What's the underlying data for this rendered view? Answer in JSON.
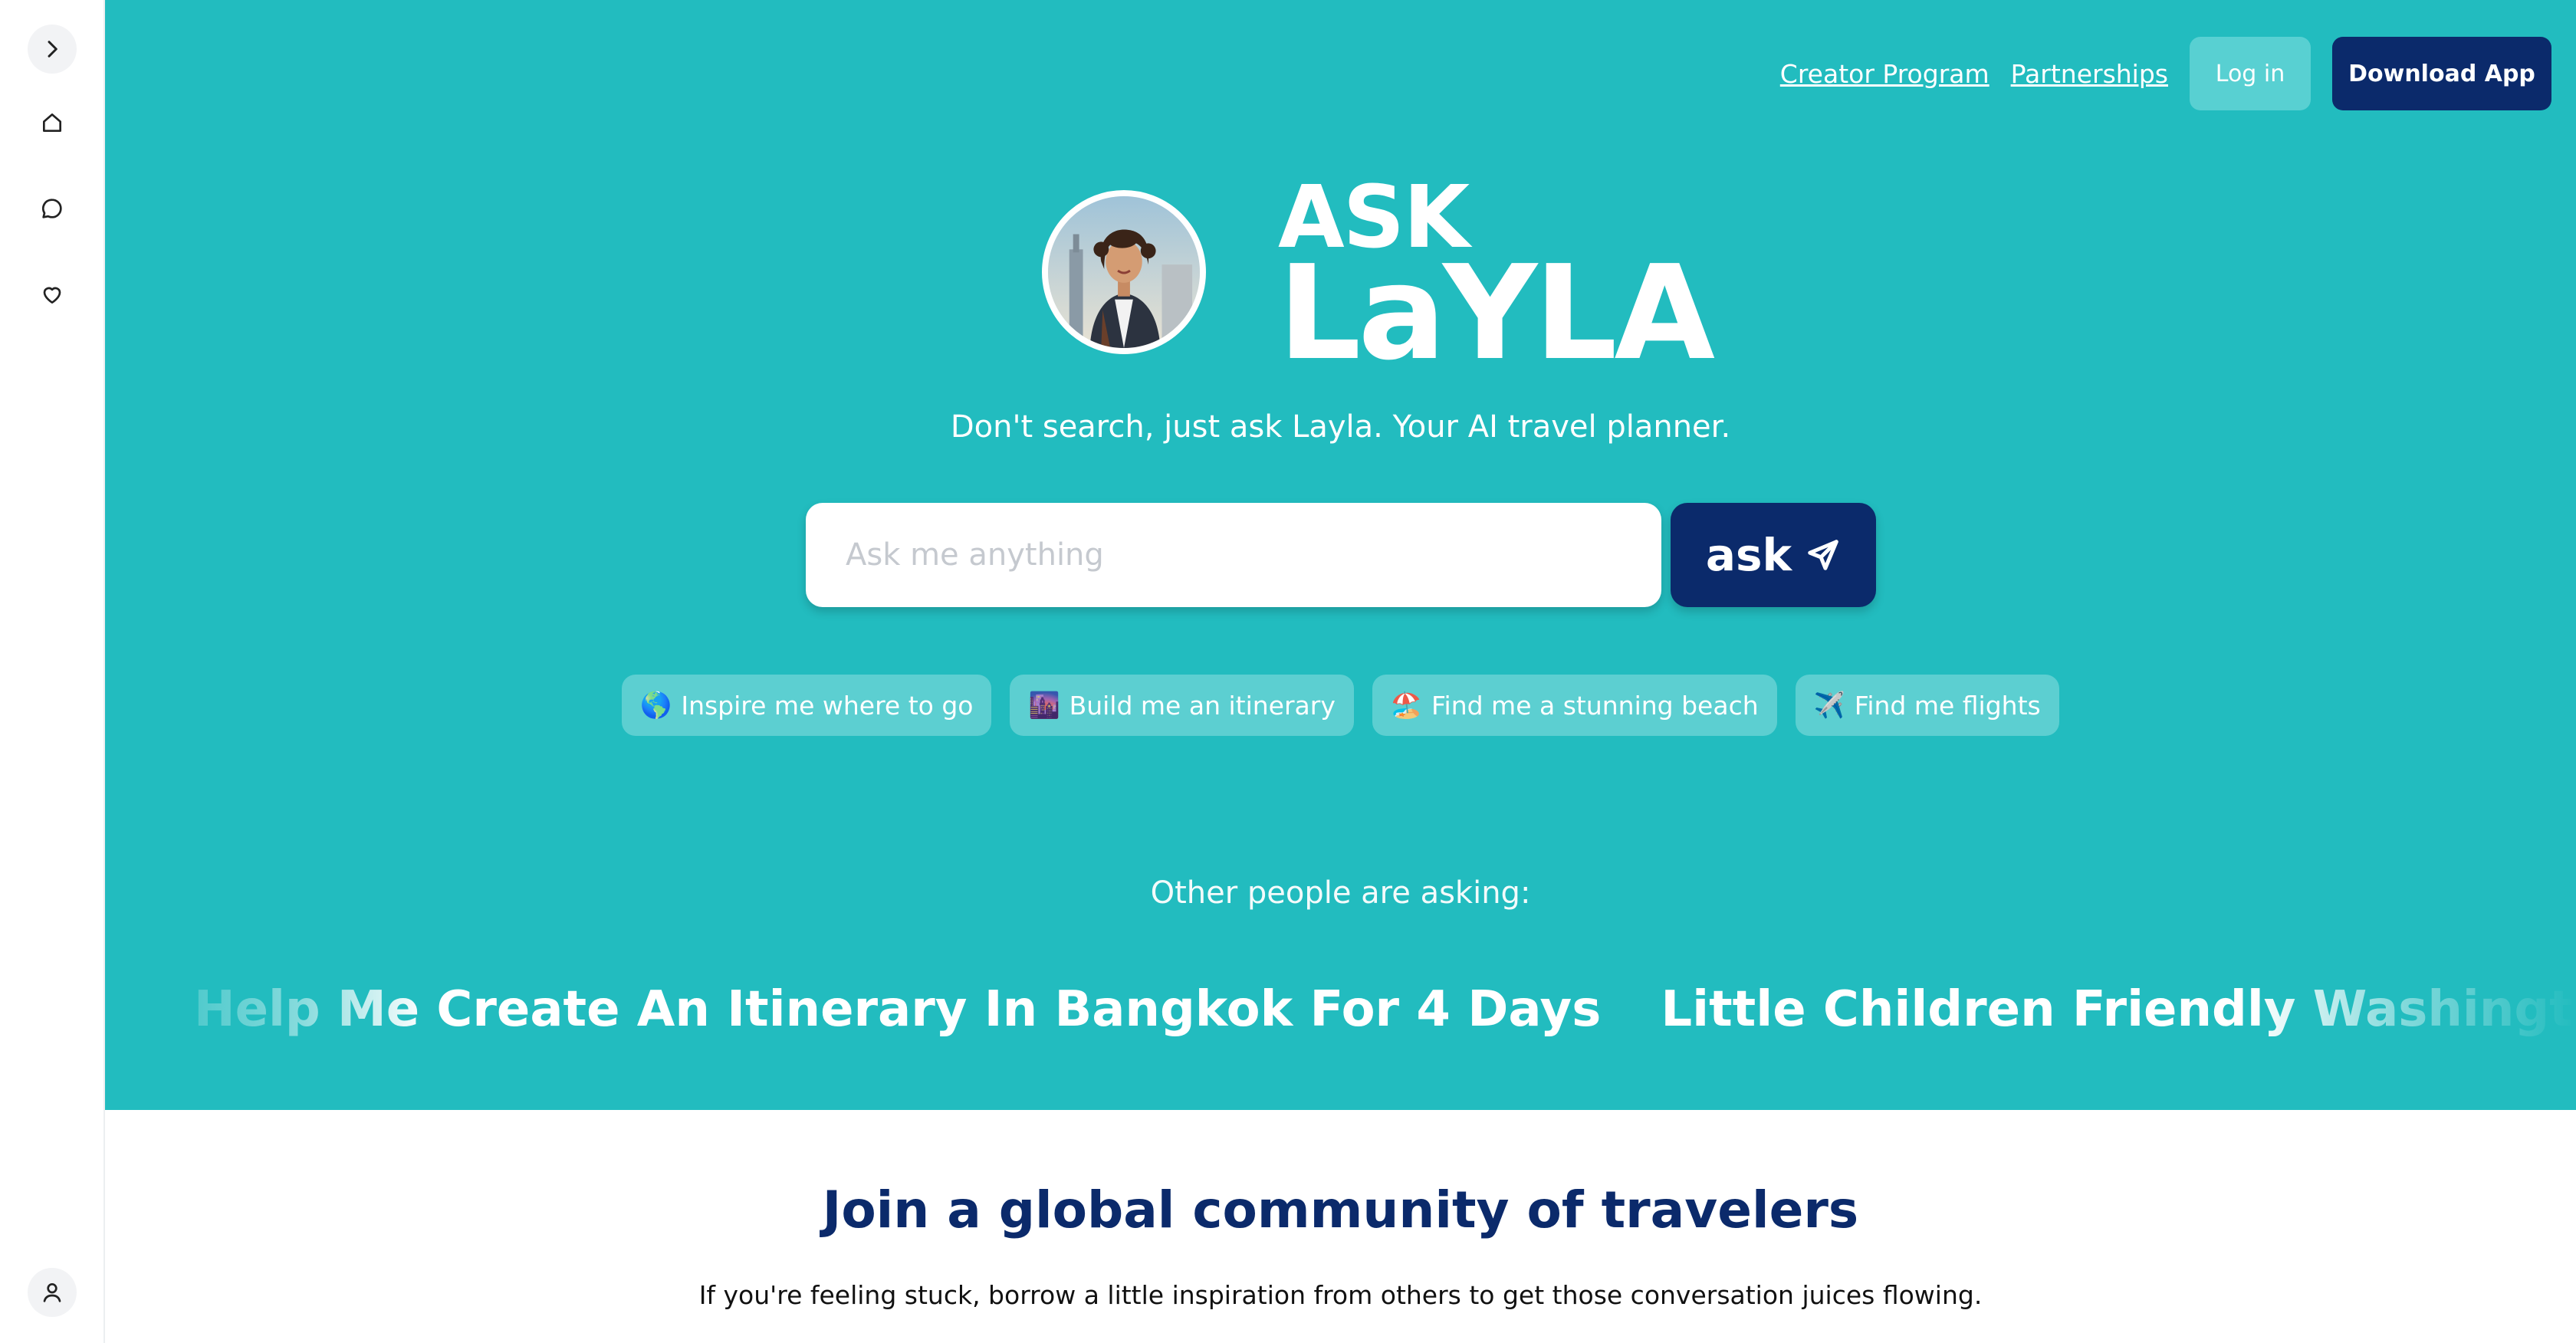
{
  "sidebar": {
    "items": [
      {
        "icon": "chevron-right-icon"
      },
      {
        "icon": "home-icon"
      },
      {
        "icon": "chat-bubble-icon"
      },
      {
        "icon": "heart-icon"
      }
    ],
    "bottom_icon": "user-icon"
  },
  "nav": {
    "creator_program": "Creator Program",
    "partnerships": "Partnerships",
    "login": "Log in",
    "download_app": "Download App"
  },
  "hero": {
    "logo_ask": "ASK",
    "logo_layla": "LaYLA",
    "tagline": "Don't search, just ask Layla. Your AI travel planner.",
    "search_placeholder": "Ask me anything",
    "ask_label": "ask",
    "chips": [
      {
        "emoji": "🌎",
        "label": "Inspire me where to go"
      },
      {
        "emoji": "🌆",
        "label": "Build me an itinerary"
      },
      {
        "emoji": "🏖️",
        "label": "Find me a stunning beach"
      },
      {
        "emoji": "✈️",
        "label": "Find me flights"
      }
    ],
    "other_asking": "Other people are asking:",
    "questions": [
      "Help Me Create An Itinerary In Bangkok For 4 Days",
      "Little Children Friendly Washington Dc Ac"
    ]
  },
  "community": {
    "title": "Join a global community of travelers",
    "subtitle": "If you're feeling stuck, borrow a little inspiration from others to get those conversation juices flowing."
  },
  "colors": {
    "teal": "#22bcbf",
    "navy": "#0b2a6b"
  }
}
